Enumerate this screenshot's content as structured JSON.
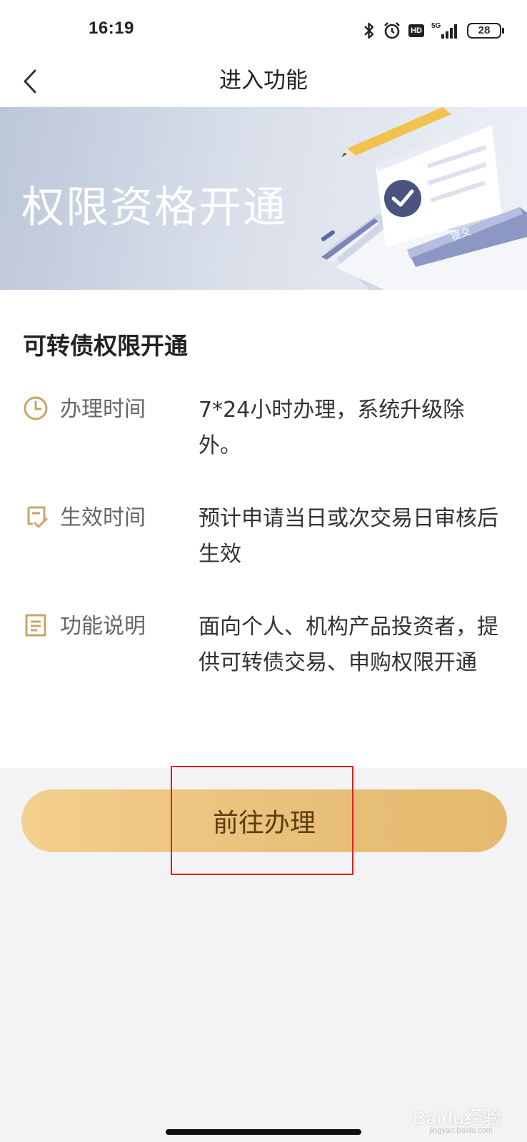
{
  "status_bar": {
    "time": "16:19",
    "network": "5G",
    "hd_label": "HD",
    "battery": "28"
  },
  "nav": {
    "title": "进入功能"
  },
  "banner": {
    "title": "权限资格开通",
    "art_button_label": "提交"
  },
  "section": {
    "title": "可转债权限开通",
    "rows": [
      {
        "icon": "clock-icon",
        "label": "办理时间",
        "value": "7*24小时办理，系统升级除外。"
      },
      {
        "icon": "checklist-icon",
        "label": "生效时间",
        "value": "预计申请当日或次交易日审核后生效"
      },
      {
        "icon": "document-icon",
        "label": "功能说明",
        "value": "面向个人、机构产品投资者，提供可转债交易、申购权限开通"
      }
    ]
  },
  "action": {
    "label": "前往办理"
  },
  "watermark": {
    "brand": "Baidu经验",
    "url": "jingyan.baidu.com"
  },
  "colors": {
    "accent_gold": "#c9a468",
    "button_gradient_start": "#f3d08c",
    "button_gradient_end": "#e5ba6f",
    "highlight": "#e02020"
  }
}
